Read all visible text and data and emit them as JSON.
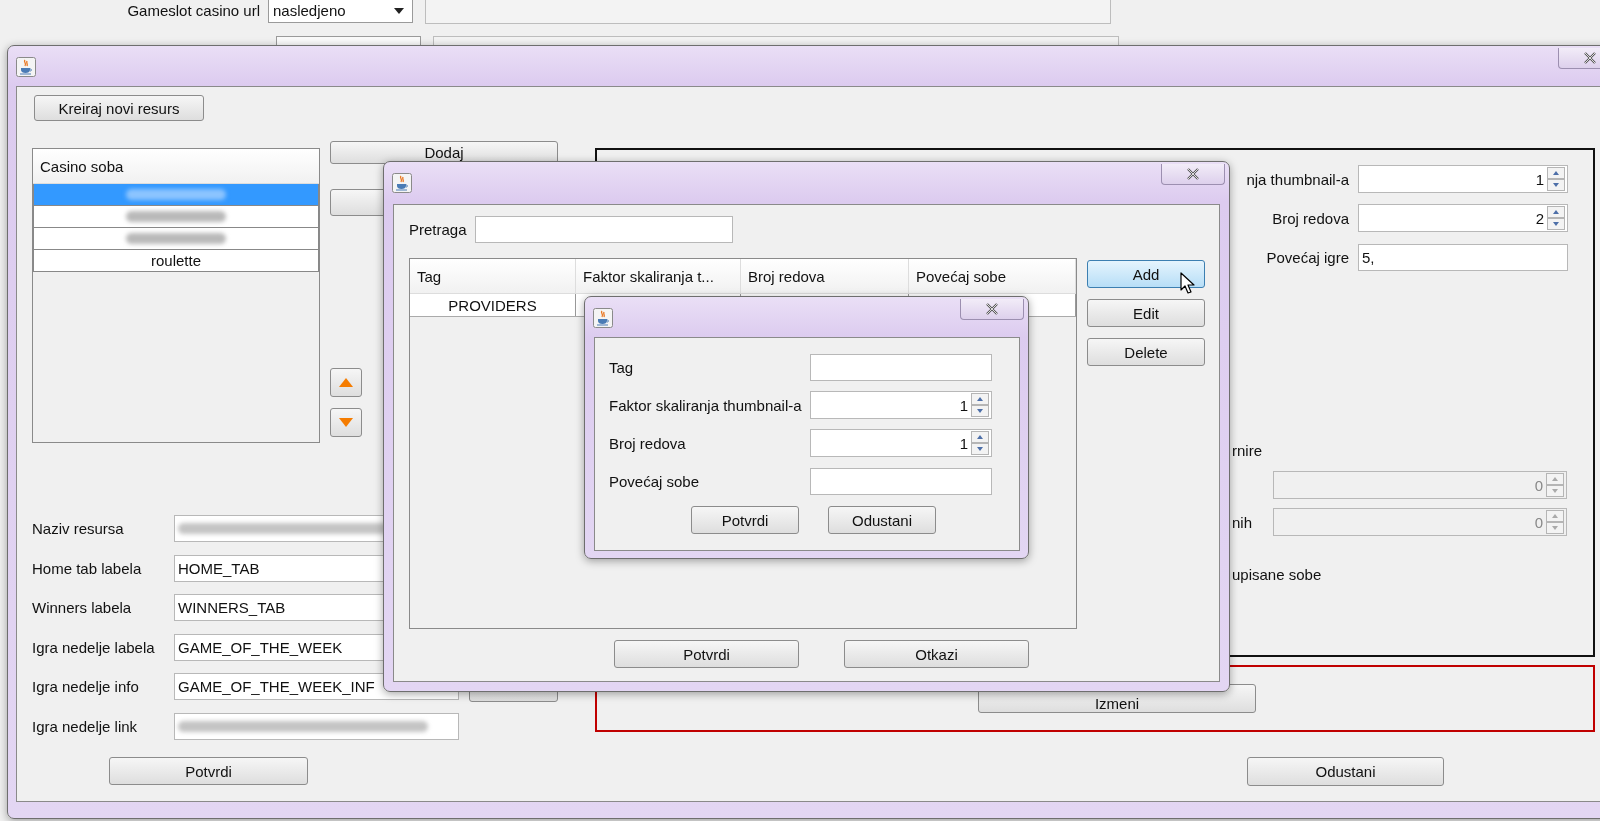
{
  "background_window": {
    "url_label": "Gameslot casino url",
    "url_mode": "nasledjeno"
  },
  "main_window": {
    "create_button": "Kreiraj novi resurs",
    "list": {
      "header": "Casino soba",
      "items": [
        {
          "blurred": true,
          "selected": true
        },
        {
          "blurred": true,
          "selected": false
        },
        {
          "blurred": true,
          "selected": false
        },
        {
          "label": "roulette",
          "blurred": false,
          "selected": false
        }
      ]
    },
    "add_button": "Dodaj",
    "form": [
      {
        "label": "Naziv resursa",
        "blurred": true
      },
      {
        "label": "Home tab labela",
        "value": "HOME_TAB",
        "blurred": false
      },
      {
        "label": "Winners labela",
        "value": "WINNERS_TAB",
        "blurred": false
      },
      {
        "label": "Igra nedelje labela",
        "value": "GAME_OF_THE_WEEK",
        "blurred": false
      },
      {
        "label": "Igra nedelje info",
        "value": "GAME_OF_THE_WEEK_INF",
        "blurred": false
      },
      {
        "label": "Igra nedelje link",
        "blurred": true
      }
    ],
    "confirm_button": "Potvrdi",
    "right_panel": {
      "fields": [
        {
          "label": "nja thumbnail-a",
          "kind": "spinner",
          "value": "1"
        },
        {
          "label": "Broj redova",
          "kind": "spinner",
          "value": "2"
        },
        {
          "label": "Povećaj igre",
          "kind": "text",
          "value": "5,"
        }
      ],
      "lower_items": [
        {
          "kind": "label",
          "text": "rnire"
        },
        {
          "kind": "spinner",
          "value": "0",
          "disabled": true
        },
        {
          "kind": "spinner",
          "label": "nih",
          "value": "0",
          "disabled": true
        },
        {
          "kind": "label",
          "text": "upisane sobe"
        }
      ]
    },
    "edit_button": "Izmeni",
    "cancel_button": "Odustani"
  },
  "lobby_dialog": {
    "search_label": "Pretraga",
    "table": {
      "columns": [
        "Tag",
        "Faktor skaliranja t...",
        "Broj redova",
        "Povećaj sobe"
      ],
      "rows": [
        {
          "tag": "PROVIDERS"
        }
      ]
    },
    "side_buttons": [
      {
        "label": "Add",
        "hovered": true
      },
      {
        "label": "Edit",
        "hovered": false
      },
      {
        "label": "Delete",
        "hovered": false
      }
    ],
    "confirm_button": "Potvrdi",
    "cancel_button": "Otkazi"
  },
  "tag_dialog": {
    "fields": [
      {
        "label": "Tag",
        "kind": "text"
      },
      {
        "label": "Faktor skaliranja thumbnail-a",
        "kind": "spinner",
        "value": "1"
      },
      {
        "label": "Broj redova",
        "kind": "spinner",
        "value": "1"
      },
      {
        "label": "Povećaj sobe",
        "kind": "text"
      }
    ],
    "confirm_button": "Potvrdi",
    "cancel_button": "Odustani"
  }
}
